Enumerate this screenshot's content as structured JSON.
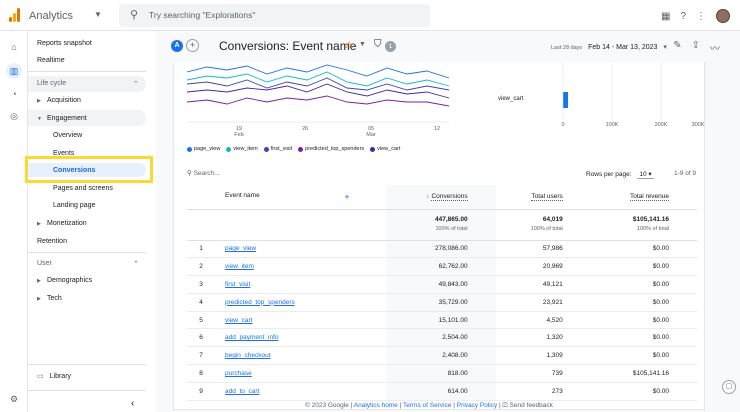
{
  "app": {
    "name": "Analytics"
  },
  "search": {
    "placeholder": "Try searching \"Explorations\""
  },
  "nav": {
    "reports_snapshot": "Reports snapshot",
    "realtime": "Realtime",
    "life_cycle": "Life cycle",
    "acquisition": "Acquisition",
    "engagement": "Engagement",
    "overview": "Overview",
    "events": "Events",
    "conversions": "Conversions",
    "pages_and_screens": "Pages and screens",
    "landing_page": "Landing page",
    "monetization": "Monetization",
    "retention": "Retention",
    "user": "User",
    "demographics": "Demographics",
    "tech": "Tech",
    "library": "Library"
  },
  "header": {
    "title": "Conversions: Event name",
    "filter_count": "1",
    "date_label": "Last 28 days",
    "date_range": "Feb 14 - Mar 13, 2023"
  },
  "chart": {
    "x_ticks": [
      "19\nFeb",
      "26",
      "05\nMar",
      "12"
    ],
    "x_tick_top": [
      "19",
      "26",
      "05",
      "12"
    ],
    "x_tick_bottom": [
      "Feb",
      "",
      "Mar",
      ""
    ],
    "zero": "0",
    "bar_label": "view_cart",
    "bar_ticks": [
      "0",
      "100K",
      "200K",
      "300K"
    ],
    "legend": [
      "page_view",
      "view_item",
      "first_visit",
      "predicted_top_spenders",
      "view_cart"
    ],
    "colors": [
      "#1a73e8",
      "#12b5cb",
      "#3949ab",
      "#7b1fa2",
      "#4527a0"
    ]
  },
  "table": {
    "search_placeholder": "Search...",
    "rows_per_page_label": "Rows per page:",
    "rows_per_page": "10",
    "pager": "1-9 of 9",
    "headers": {
      "event_name": "Event name",
      "conversions": "Conversions",
      "total_users": "Total users",
      "total_revenue": "Total revenue"
    },
    "totals": {
      "conversions": "447,865.00",
      "conversions_pct": "100% of total",
      "users": "64,019",
      "users_pct": "100% of total",
      "revenue": "$105,141.16",
      "revenue_pct": "100% of total"
    },
    "rows": [
      {
        "n": "1",
        "name": "page_view",
        "conv": "278,086.00",
        "users": "57,986",
        "rev": "$0.00"
      },
      {
        "n": "2",
        "name": "view_item",
        "conv": "62,762.00",
        "users": "20,969",
        "rev": "$0.00"
      },
      {
        "n": "3",
        "name": "first_visit",
        "conv": "49,843.00",
        "users": "49,121",
        "rev": "$0.00"
      },
      {
        "n": "4",
        "name": "predicted_top_spenders",
        "conv": "35,729.00",
        "users": "23,921",
        "rev": "$0.00"
      },
      {
        "n": "5",
        "name": "view_cart",
        "conv": "15,101.00",
        "users": "4,520",
        "rev": "$0.00"
      },
      {
        "n": "6",
        "name": "add_payment_info",
        "conv": "2,504.00",
        "users": "1,320",
        "rev": "$0.00"
      },
      {
        "n": "7",
        "name": "begin_checkout",
        "conv": "2,408.00",
        "users": "1,309",
        "rev": "$0.00"
      },
      {
        "n": "8",
        "name": "purchase",
        "conv": "818.00",
        "users": "739",
        "rev": "$105,141.16"
      },
      {
        "n": "9",
        "name": "add_to_cart",
        "conv": "614.00",
        "users": "273",
        "rev": "$0.00"
      }
    ]
  },
  "footer": {
    "copyright": "© 2023 Google | ",
    "home": "Analytics home",
    "sep1": " | ",
    "terms": "Terms of Service",
    "sep2": " | ",
    "privacy": "Privacy Policy",
    "sep3": " | ",
    "feedback": "Send feedback"
  }
}
